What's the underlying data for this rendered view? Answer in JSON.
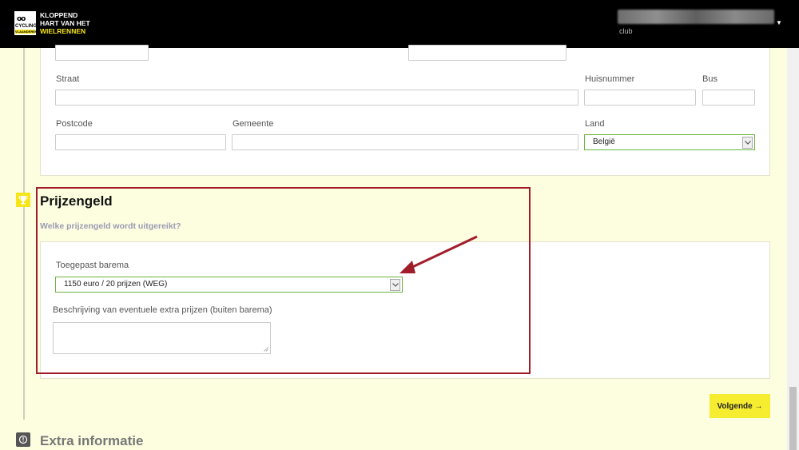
{
  "header": {
    "logo_badge_lines": [
      "CYCLING",
      "VLAANDEREN"
    ],
    "logo_text_lines": [
      "KLOPPEND",
      "HART VAN HET"
    ],
    "logo_text_highlight": "WIELRENNEN",
    "user_role": "club"
  },
  "address": {
    "street_label": "Straat",
    "number_label": "Huisnummer",
    "box_label": "Bus",
    "postcode_label": "Postcode",
    "city_label": "Gemeente",
    "country_label": "Land",
    "country_value": "België"
  },
  "prize": {
    "title": "Prijzengeld",
    "subtitle": "Welke prijzengeld wordt uitgereikt?",
    "scale_label": "Toegepast barema",
    "scale_value": "1150 euro / 20 prijzen (WEG)",
    "extra_label": "Beschrijving van eventuele extra prijzen (buiten barema)"
  },
  "actions": {
    "next_label": "Volgende",
    "next_arrow": "→"
  },
  "extra": {
    "title": "Extra informatie"
  },
  "colors": {
    "accent_yellow": "#f6e51a",
    "highlight_red": "#a11d2a",
    "select_green": "#6cb33e"
  },
  "icons": [
    "trophy-icon",
    "info-icon",
    "chevron-down-icon",
    "arrow-right-icon"
  ]
}
